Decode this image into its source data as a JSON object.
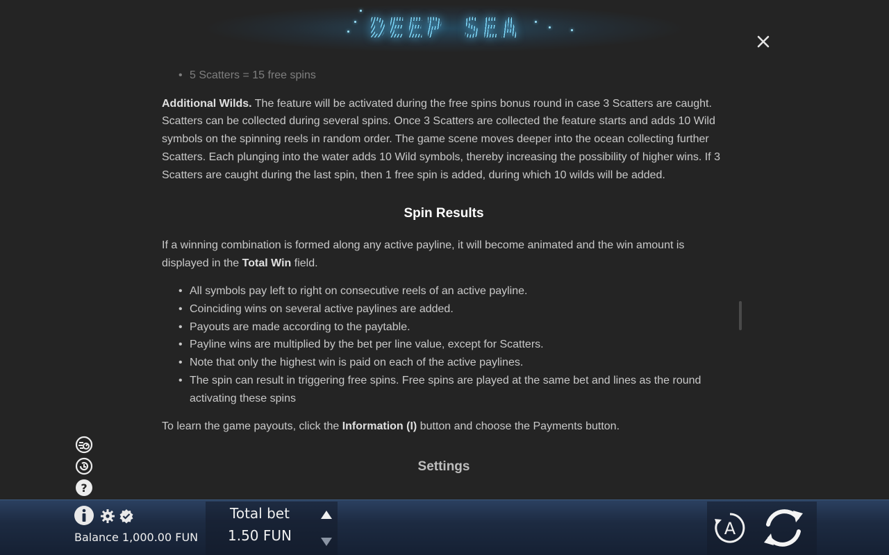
{
  "header": {
    "logo_text": "DEEP SEA",
    "close_symbol": "✕"
  },
  "content": {
    "prev_list_item": "5 Scatters = 15 free spins",
    "additional_wilds_title": "Additional Wilds.",
    "additional_wilds_text": "The feature will be activated during the free spins bonus round in case 3 Scatters are caught. Scatters can be collected during several spins. Once 3 Scatters are collected the feature starts and adds 10 Wild symbols on the spinning reels in random order. The game scene moves deeper into the ocean collecting further Scatters. Each plunging into the water adds 10 Wild symbols, thereby increasing the possibility of higher wins. If 3 Scatters are caught during the last spin, then 1 free spin is added, during which 10 wilds will be added.",
    "spin_results_title": "Spin Results",
    "spin_results_intro_before": "If a winning combination is formed along any active payline, it will become animated and the win amount is displayed in the",
    "spin_results_intro_bold": "Total Win",
    "spin_results_intro_after": "field.",
    "spin_results_items": [
      "All symbols pay left to right on consecutive reels of an active payline.",
      "Coinciding wins on several active paylines are added.",
      "Payouts are made according to the paytable.",
      "Payline wins are multiplied by the bet per line value, except for Scatters.",
      "Note that only the highest win is paid on each of the active paylines.",
      "The spin can result in triggering free spins. Free spins are played at the same bet and lines as the round activating these spins"
    ],
    "payouts_before": "To learn the game payouts, click the",
    "payouts_bold": "Information (I)",
    "payouts_after": "button and choose the Payments button.",
    "settings_title": "Settings"
  },
  "side_icons": [
    "speed-icon",
    "history-icon",
    "help-icon"
  ],
  "bottom_bar": {
    "balance": "Balance 1,000.00 FUN",
    "total_bet_label": "Total bet",
    "total_bet_value": "1.50 FUN",
    "autoplay_letter": "A"
  }
}
